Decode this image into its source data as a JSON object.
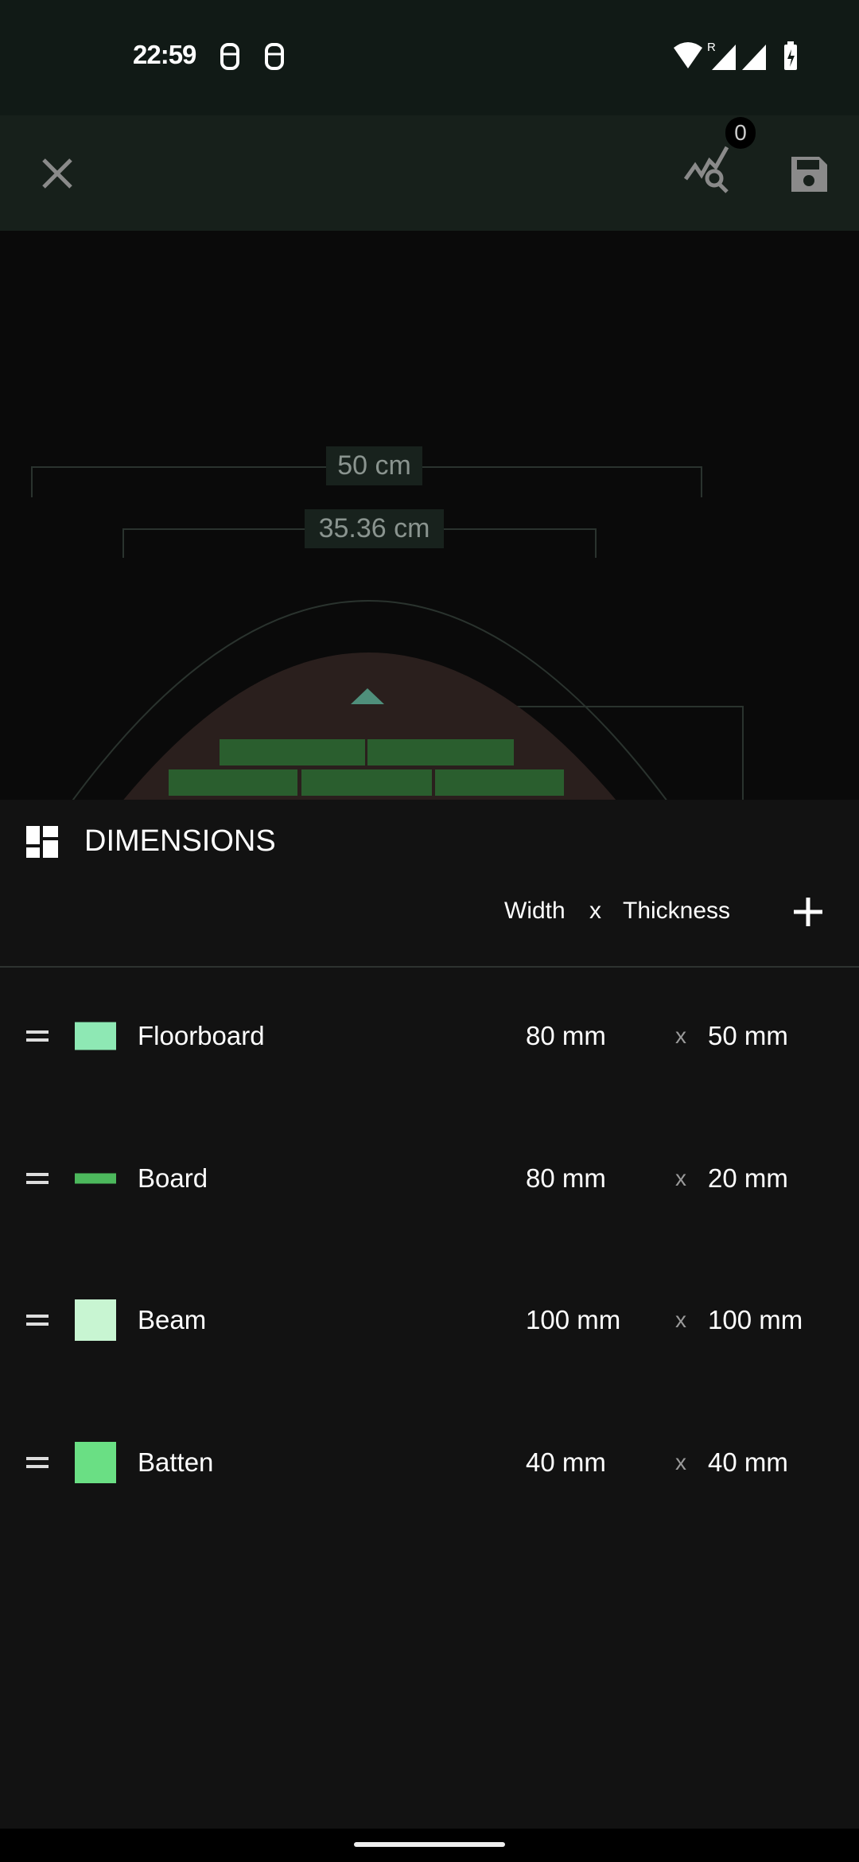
{
  "status_bar": {
    "time": "22:59",
    "roaming": "R",
    "icons": [
      "notification-icon",
      "notification-icon",
      "wifi-icon",
      "signal-icon",
      "signal-icon",
      "battery-charging-icon"
    ]
  },
  "toolbar": {
    "close_icon": "close-icon",
    "analysis_icon": "chart-search-icon",
    "badge_count": "0",
    "save_icon": "save-icon"
  },
  "canvas": {
    "dimension_outer": "50 cm",
    "dimension_inner": "35.36 cm",
    "brick_color": "#2a5e2e",
    "trunk_color": "#2a1f1d"
  },
  "panel": {
    "title": "DIMENSIONS",
    "columns": {
      "width": "Width",
      "separator": "x",
      "thickness": "Thickness"
    },
    "add_icon": "plus-icon",
    "items": [
      {
        "name": "Floorboard",
        "width": "80 mm",
        "separator": "x",
        "thickness": "50 mm",
        "color": "#8ee8b4"
      },
      {
        "name": "Board",
        "width": "80 mm",
        "separator": "x",
        "thickness": "20 mm",
        "color": "#4cb85c"
      },
      {
        "name": "Beam",
        "width": "100 mm",
        "separator": "x",
        "thickness": "100 mm",
        "color": "#c8f5d2"
      },
      {
        "name": "Batten",
        "width": "40 mm",
        "separator": "x",
        "thickness": "40 mm",
        "color": "#6adf84"
      }
    ]
  }
}
